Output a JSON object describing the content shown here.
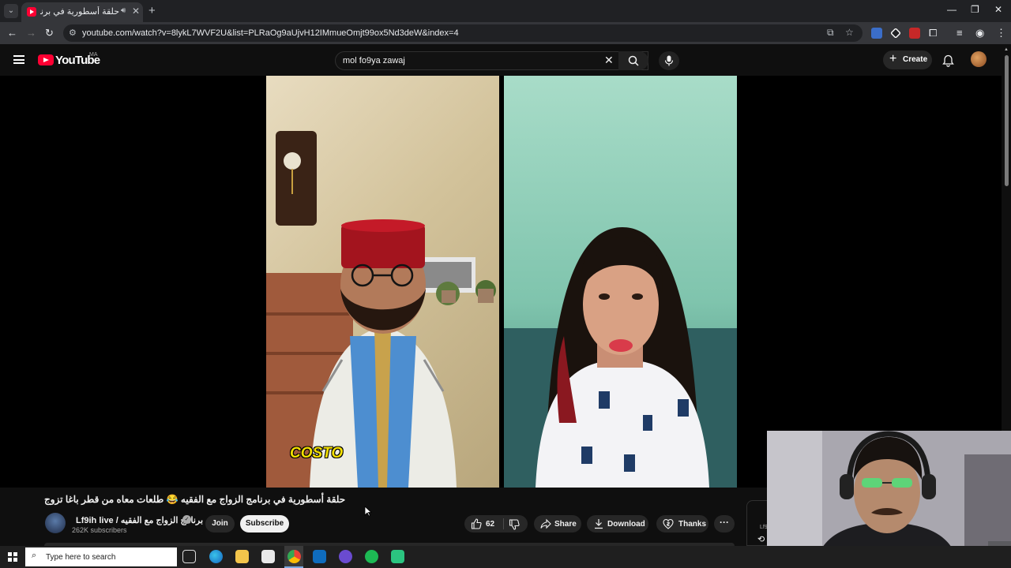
{
  "browser": {
    "tab_title": "حلقة أسطورية في برنامج الزواج",
    "url": "youtube.com/watch?v=8lykL7WVF2U&list=PLRaOg9aUjvH12IMmueOmjt99ox5Nd3deW&index=4"
  },
  "header": {
    "logo_text": "YouTube",
    "region": "MA",
    "search_value": "mol fo9ya zawaj",
    "create_label": "Create"
  },
  "video": {
    "caption": "COSTO",
    "title": "حلقة أسطورية في برنامج الزواج مع الفقيه 😂 طلعات معاه من قطر باغا تزوج"
  },
  "channel": {
    "name": "Lf9ih live / برنامج الزواج مع الفقيه",
    "subscribers": "262K subscribers",
    "join_label": "Join",
    "subscribe_label": "Subscribe"
  },
  "actions": {
    "likes": "62",
    "share_label": "Share",
    "download_label": "Download",
    "thanks_label": "Thanks"
  },
  "side_panel": {
    "text": "Lf9"
  },
  "taskbar": {
    "search_placeholder": "Type here to search"
  },
  "colors": {
    "background": "#0f0f0f",
    "brand_red": "#ff0033",
    "caption_yellow": "#f4e000"
  },
  "icons": [
    "youtube-logo-icon",
    "hamburger-icon",
    "search-icon",
    "clear-icon",
    "microphone-icon",
    "plus-icon",
    "bell-icon",
    "verified-icon",
    "like-icon",
    "dislike-icon",
    "share-icon",
    "download-icon",
    "thanks-icon",
    "more-icon",
    "windows-start-icon"
  ]
}
